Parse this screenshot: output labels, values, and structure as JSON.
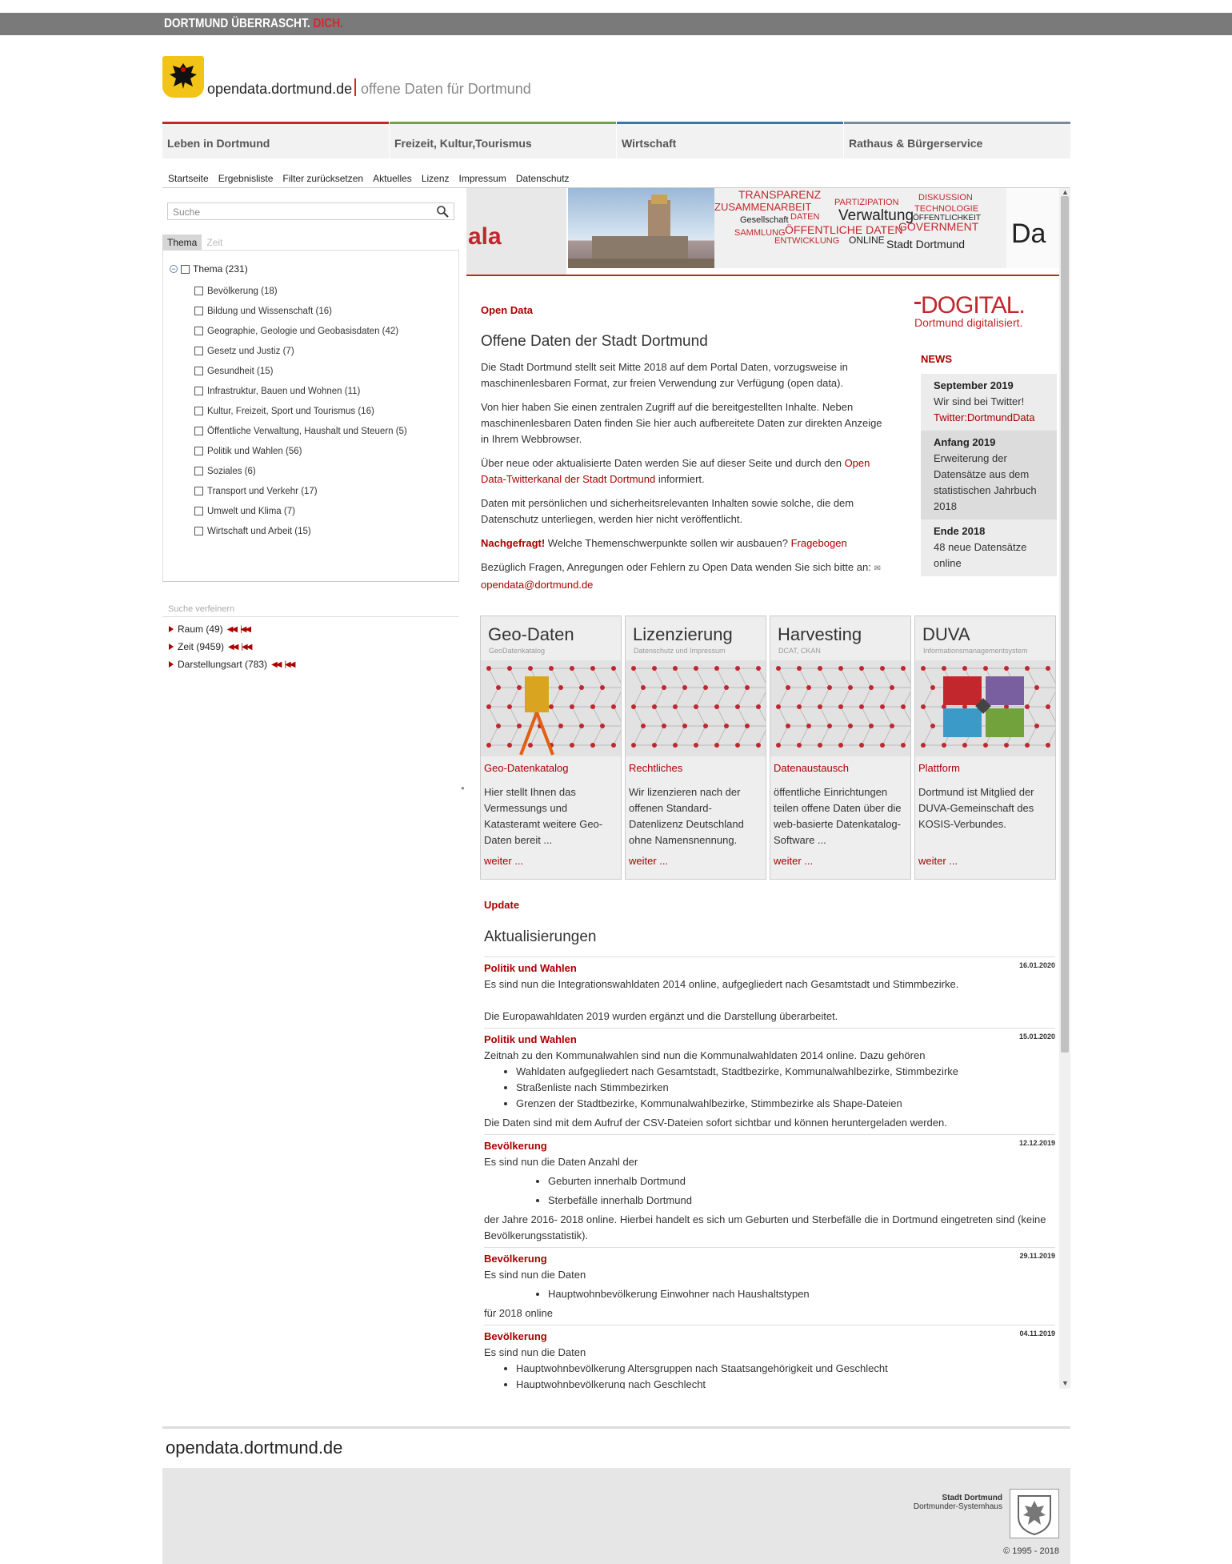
{
  "topbar": {
    "claim_main": "DORTMUND ÜBERRASCHT.",
    "claim_accent": "DICH."
  },
  "header": {
    "site_name": "opendata.dortmund.de",
    "site_sub": "offene Daten für Dortmund"
  },
  "main_nav": [
    "Leben in Dortmund",
    "Freizeit, Kultur,Tourismus",
    "Wirtschaft",
    "Rathaus & Bürgerservice"
  ],
  "sub_nav": [
    "Startseite",
    "Ergebnisliste",
    "Filter zurücksetzen",
    "Aktuelles",
    "Lizenz",
    "Impressum",
    "Datenschutz"
  ],
  "search": {
    "placeholder": "Suche"
  },
  "tabs": {
    "active": "Thema",
    "inactive": "Zeit"
  },
  "tree": {
    "root": "Thema  (231)",
    "items": [
      "Bevölkerung  (18)",
      "Bildung und Wissenschaft  (16)",
      "Geographie, Geologie und Geobasisdaten  (42)",
      "Gesetz und Justiz  (7)",
      "Gesundheit  (15)",
      "Infrastruktur, Bauen und Wohnen  (11)",
      "Kultur, Freizeit, Sport und Tourismus  (16)",
      "Öffentliche Verwaltung, Haushalt und Steuern  (5)",
      "Politik und Wahlen  (56)",
      "Soziales  (6)",
      "Transport und Verkehr  (17)",
      "Umwelt und Klima  (7)",
      "Wirtschaft und Arbeit  (15)"
    ]
  },
  "refine": {
    "label": "Suche verfeinern",
    "facets": [
      "Raum  (49)",
      "Zeit  (9459)",
      "Darstellungsart  (783)"
    ]
  },
  "banner": {
    "left_text": "ala",
    "words": [
      "TRANSPARENZ",
      "ZUSAMMENARBEIT",
      "Verwaltung",
      "GOVERNMENT",
      "ÖFFENTLICHE DATEN",
      "Stadt Dortmund",
      "DISKUSSION",
      "TECHNOLOGIE",
      "PARTIZIPATION",
      "Gesellschaft",
      "DATEN",
      "ENTWICKLUNG",
      "ONLINE",
      "SAMMLUNG",
      "ÖFFENTLICHKEIT"
    ],
    "right_text": "Da"
  },
  "opendata": {
    "kicker": "Open Data",
    "title": "Offene Daten der Stadt Dortmund",
    "p1": "Die Stadt Dortmund stellt seit Mitte 2018 auf dem Portal Daten, vorzugsweise in maschinenlesbaren Format, zur freien Verwendung zur Verfügung (open data).",
    "p2": "Von hier haben Sie einen zentralen Zugriff auf die bereitgestellten Inhalte. Neben maschinenlesbaren Daten finden Sie hier auch aufbereitete Daten zur direkten Anzeige in Ihrem Webbrowser.",
    "p3a": "Über neue oder aktualisierte Daten werden Sie auf dieser Seite und durch den ",
    "p3link": "Open Data-Twitterkanal der Stadt Dortmund",
    "p3b": " informiert.",
    "p4": "Daten mit persönlichen und sicherheitsrelevanten Inhalten sowie solche, die dem Datenschutz unterliegen, werden hier nicht veröffentlicht.",
    "p5a": "Nachgefragt!",
    "p5b": " Welche Themenschwerpunkte sollen wir ausbauen? ",
    "p5link": "Fragebogen",
    "p6": "Bezüglich Fragen, Anregungen oder Fehlern zu Open Data wenden Sie sich bitte an: ",
    "p6link": "opendata@dortmund.de"
  },
  "dogital": {
    "word": "DOGITAL.",
    "sub": "Dortmund digitalisiert."
  },
  "news": {
    "heading": "NEWS",
    "items": [
      {
        "title": "September 2019",
        "text": "Wir sind bei Twitter!",
        "link": "Twitter:DortmundData"
      },
      {
        "title": "Anfang 2019",
        "text": "Erweiterung der Datensätze aus dem statistischen Jahrbuch 2018",
        "link": ""
      },
      {
        "title": "Ende 2018",
        "text": "48 neue Datensätze online",
        "link": ""
      }
    ]
  },
  "tiles": [
    {
      "title": "Geo-Daten",
      "sub": "GeoDatenkatalog",
      "link": "Geo-Datenkatalog",
      "text": "Hier stellt Ihnen das Vermessungs und Katasteramt weitere Geo-Daten bereit ...",
      "more": "weiter ..."
    },
    {
      "title": "Lizenzierung",
      "sub": "Datenschutz und Impressum",
      "link": "Rechtliches",
      "text": "Wir lizenzieren nach der offenen Standard-Datenlizenz Deutschland ohne Namensnennung.",
      "more": "weiter ..."
    },
    {
      "title": "Harvesting",
      "sub": "DCAT, CKAN",
      "link": "Datenaustausch",
      "text": "öffentliche Einrichtungen teilen offene Daten über die web-basierte Datenkatalog-Software ...",
      "more": "weiter ..."
    },
    {
      "title": "DUVA",
      "sub": "Informationsmanagementsystem",
      "link": "Plattform",
      "text": "Dortmund ist Mitglied der DUVA-Gemeinschaft des KOSIS-Verbundes.",
      "more": "weiter ..."
    }
  ],
  "updates": {
    "kicker": "Update",
    "title": "Aktualisierungen",
    "entries": [
      {
        "title": "Politik und Wahlen",
        "date": "16.01.2020",
        "l1": "Es sind nun die Integrationswahldaten 2014 online, aufgegliedert nach Gesamtstadt und Stimmbezirke.",
        "l2": "Die Europawahldaten 2019 wurden ergänzt und die Darstellung überarbeitet."
      },
      {
        "title": "Politik und Wahlen",
        "date": "15.01.2020",
        "l1": "Zeitnah zu den Kommunalwahlen sind nun die Kommunalwahldaten 2014 online. Dazu gehören",
        "b1": "Wahldaten aufgegliedert nach Gesamtstadt, Stadtbezirke, Kommunalwahlbezirke, Stimmbezirke",
        "b2": "Straßenliste nach Stimmbezirken",
        "b3": "Grenzen der Stadtbezirke, Kommunalwahlbezirke, Stimmbezirke als Shape-Dateien",
        "l2": "Die Daten sind mit dem Aufruf der CSV-Dateien sofort sichtbar und können heruntergeladen werden."
      },
      {
        "title": "Bevölkerung",
        "date": "12.12.2019",
        "l1": "Es sind nun die Daten Anzahl der",
        "b1": "Geburten innerhalb Dortmund",
        "b2": "Sterbefälle innerhalb Dortmund",
        "l2": "der Jahre 2016- 2018 online. Hierbei handelt es sich um Geburten und Sterbefälle die in Dortmund eingetreten sind (keine Bevölkerungsstatistik)."
      },
      {
        "title": "Bevölkerung",
        "date": "29.11.2019",
        "l1": "Es sind nun die Daten",
        "b1": "Hauptwohnbevölkerung Einwohner nach Haushaltstypen",
        "l2": "für 2018 online"
      },
      {
        "title": "Bevölkerung",
        "date": "04.11.2019",
        "l1": "Es sind nun die Daten",
        "b1": "Hauptwohnbevölkerung Altersgruppen nach Staatsangehörigkeit und Geschlecht",
        "b2": "Hauptwohnbevölkerung nach Geschlecht"
      }
    ]
  },
  "footer": {
    "site": "opendata.dortmund.de",
    "stadt": "Stadt Dortmund",
    "haus": "Dortmunder-Systemhaus",
    "copy": "© 1995 - 2018"
  }
}
